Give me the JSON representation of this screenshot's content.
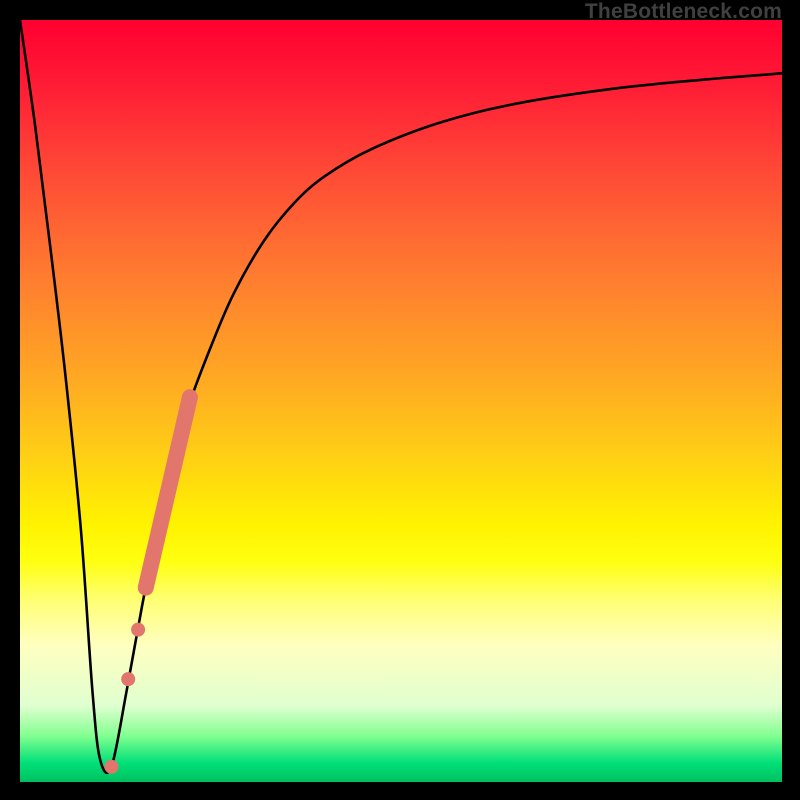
{
  "source_label": "TheBottleneck.com",
  "chart_data": {
    "type": "line",
    "title": "",
    "xlabel": "",
    "ylabel": "",
    "xlim": [
      0,
      100
    ],
    "ylim": [
      0,
      100
    ],
    "series": [
      {
        "name": "bottleneck-curve",
        "x": [
          0,
          2,
          4,
          6,
          8,
          9.5,
          10.5,
          12,
          14,
          16,
          18,
          20,
          22,
          25,
          28,
          32,
          36,
          40,
          46,
          55,
          65,
          78,
          90,
          100
        ],
        "y": [
          100,
          86,
          70,
          53,
          33,
          12,
          3,
          2,
          12,
          23,
          33,
          41.5,
          49,
          57,
          64,
          71,
          76,
          79.5,
          83,
          86.5,
          89,
          91,
          92.2,
          93
        ]
      }
    ],
    "markers": [
      {
        "name": "marker-segment-start",
        "x": 22.3,
        "y": 50.5
      },
      {
        "name": "marker-segment-end",
        "x": 16.5,
        "y": 25.5
      },
      {
        "name": "marker-dot-1",
        "x": 15.5,
        "y": 20
      },
      {
        "name": "marker-dot-2",
        "x": 14.2,
        "y": 13.5
      },
      {
        "name": "marker-dot-3",
        "x": 12,
        "y": 2
      }
    ],
    "marker_color": "#e2766c",
    "gradient_stops": [
      {
        "pos": 0,
        "color": "#ff0030"
      },
      {
        "pos": 66,
        "color": "#fff200"
      },
      {
        "pos": 100,
        "color": "#00c060"
      }
    ]
  }
}
